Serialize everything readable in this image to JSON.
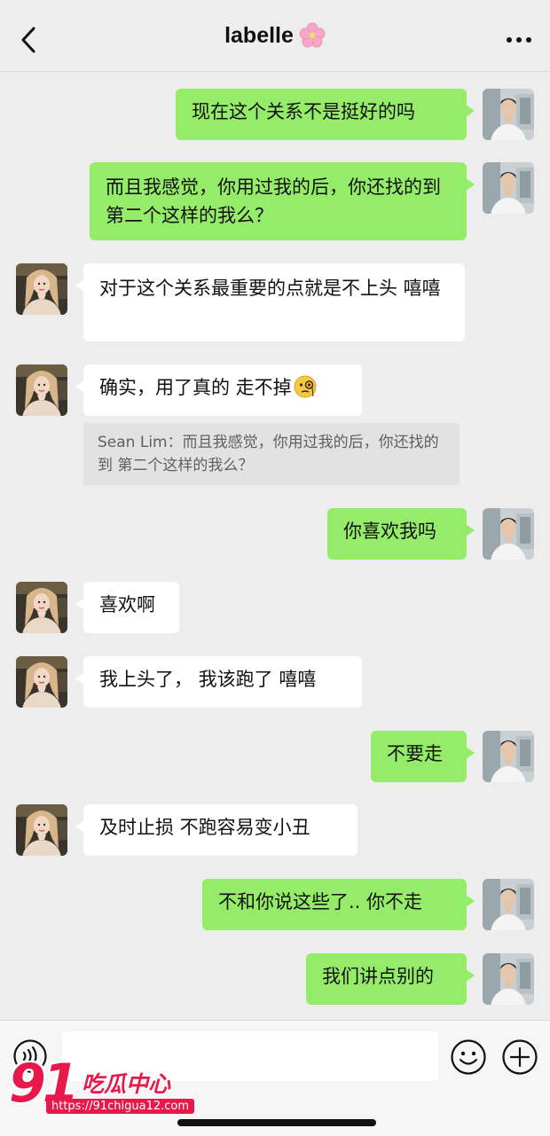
{
  "header": {
    "title": "labelle",
    "title_icon": "cherry-blossom-icon",
    "back_icon": "chevron-left-icon",
    "more_icon": "more-dots-icon"
  },
  "messages": [
    {
      "side": "out",
      "text": "现在这个关系不是挺好的吗"
    },
    {
      "side": "out",
      "text": "而且我感觉，你用过我的后，你还找的到 第二个这样的我么？"
    },
    {
      "side": "in",
      "text": "对于这个关系最重要的点就是不上头 嘻嘻"
    },
    {
      "side": "in",
      "text": "确实，用了真的 走不掉",
      "emoji": "face-with-monocle-emoji",
      "quote": "Sean Lim：而且我感觉，你用过我的后，你还找的到 第二个这样的我么？"
    },
    {
      "side": "out",
      "text": "你喜欢我吗"
    },
    {
      "side": "in",
      "text": "喜欢啊"
    },
    {
      "side": "in",
      "text": "我上头了， 我该跑了 嘻嘻"
    },
    {
      "side": "out",
      "text": "不要走"
    },
    {
      "side": "in",
      "text": "及时止损 不跑容易变小丑"
    },
    {
      "side": "out",
      "text": "不和你说这些了.. 你不走"
    },
    {
      "side": "out",
      "text": "我们讲点别的"
    }
  ],
  "input_bar": {
    "value": "",
    "voice_icon": "voice-icon",
    "emoji_icon": "smiley-icon",
    "plus_icon": "plus-icon"
  },
  "watermark": {
    "number": "91",
    "text": "吃瓜中心",
    "url": "https://91chigua12.com"
  },
  "colors": {
    "out_bubble": "#95ec69",
    "in_bubble": "#ffffff",
    "background": "#ededed",
    "watermark": "#e8194a"
  }
}
